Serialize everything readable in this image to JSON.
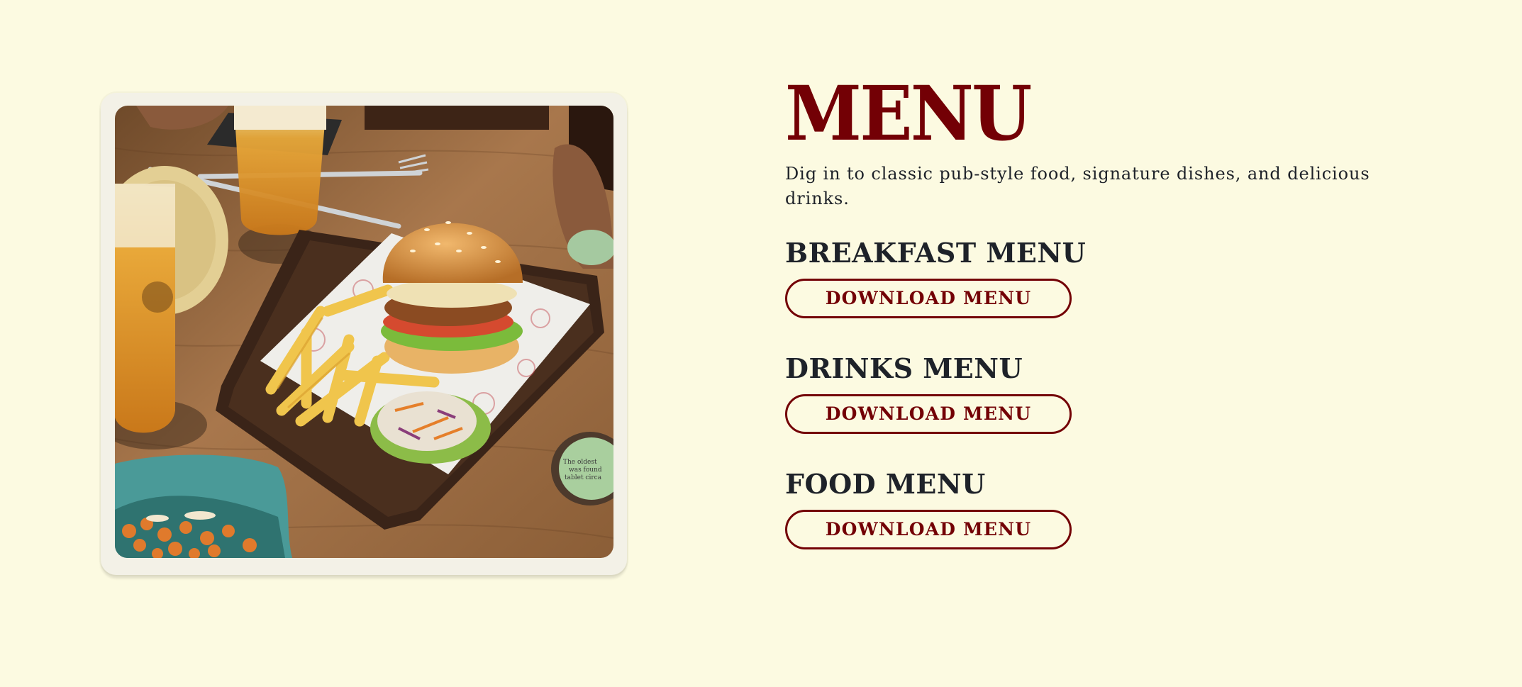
{
  "colors": {
    "page_background": "#fcfae1",
    "brand_maroon": "#730005",
    "text_dark": "#1e2229"
  },
  "hero_image": {
    "subject": "burger with fries and coleslaw on a wooden board, glasses of beer on a wooden table"
  },
  "menu": {
    "title": "MENU",
    "intro": "Dig in to classic pub-style food, signature dishes, and delicious drinks.",
    "sections": [
      {
        "title": "BREAKFAST MENU",
        "button_label": "DOWNLOAD MENU"
      },
      {
        "title": "DRINKS MENU",
        "button_label": "DOWNLOAD MENU"
      },
      {
        "title": "FOOD MENU",
        "button_label": "DOWNLOAD MENU"
      }
    ]
  }
}
